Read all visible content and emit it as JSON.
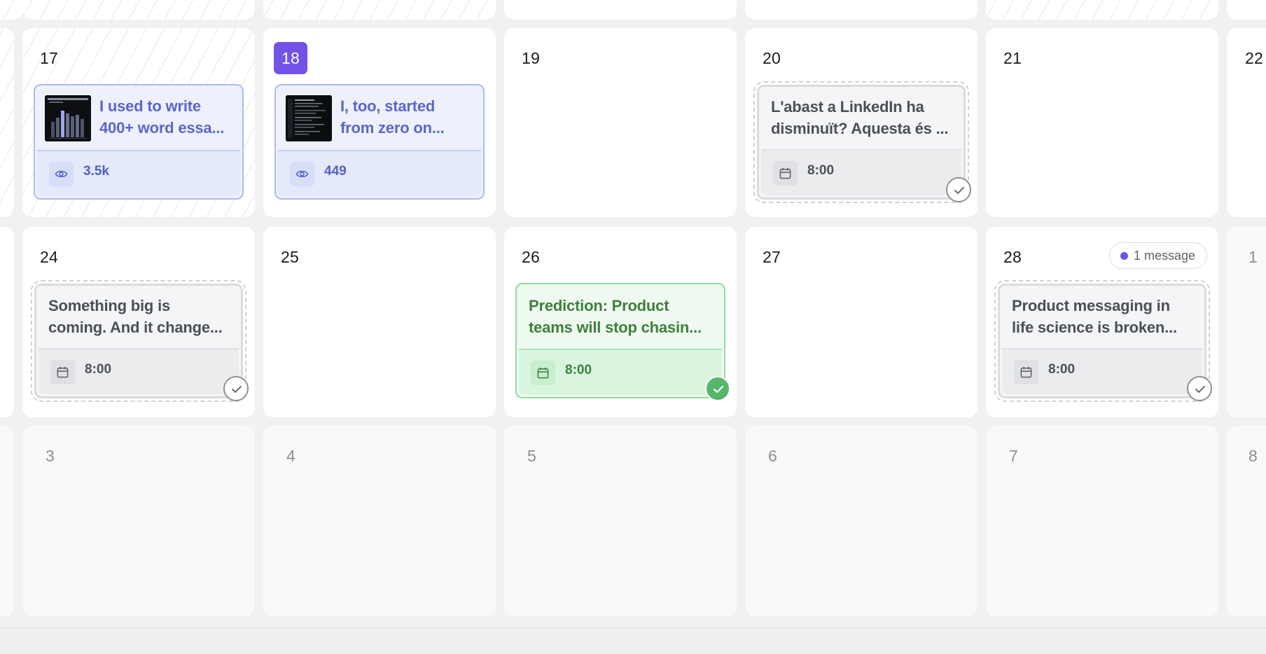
{
  "calendar": {
    "today_day": "18",
    "colors": {
      "today_accent": "#7352e8",
      "published": "#5b66cc",
      "scheduled": "#4c4f55",
      "approved": "#56b66a",
      "message_dot": "#7352e8"
    },
    "weeks": [
      {
        "days": [
          {
            "day": "17",
            "post": {
              "status": "published",
              "title_lines": [
                "I used to write",
                "400+ word essa..."
              ],
              "metric_icon": "eye-icon",
              "metric": "3.5k",
              "has_thumbnail": true
            }
          },
          {
            "day": "18",
            "today": true,
            "post": {
              "status": "published",
              "title_lines": [
                "I, too, started",
                "from zero on..."
              ],
              "metric_icon": "eye-icon",
              "metric": "449",
              "has_thumbnail": true
            }
          },
          {
            "day": "19"
          },
          {
            "day": "20",
            "post": {
              "status": "scheduled",
              "title_lines": [
                "L'abast a LinkedIn ha",
                "disminuït? Aquesta és ..."
              ],
              "metric_icon": "calendar-icon",
              "metric": "8:00",
              "approval": "pending"
            }
          },
          {
            "day": "21"
          },
          {
            "day": "22"
          }
        ]
      },
      {
        "days": [
          {
            "day": "24",
            "post": {
              "status": "scheduled",
              "title_lines": [
                "Something big is",
                "coming. And it change..."
              ],
              "metric_icon": "calendar-icon",
              "metric": "8:00",
              "approval": "pending"
            }
          },
          {
            "day": "25"
          },
          {
            "day": "26",
            "post": {
              "status": "approved",
              "title_lines": [
                "Prediction: Product",
                "teams will stop chasin..."
              ],
              "metric_icon": "calendar-icon",
              "metric": "8:00",
              "approval": "done"
            }
          },
          {
            "day": "27"
          },
          {
            "day": "28",
            "message_badge": "1 message",
            "post": {
              "status": "scheduled",
              "title_lines": [
                "Product messaging in",
                "life science is broken..."
              ],
              "metric_icon": "calendar-icon",
              "metric": "8:00",
              "approval": "pending"
            }
          },
          {
            "day": "1"
          }
        ]
      },
      {
        "days": [
          {
            "day": "3"
          },
          {
            "day": "4"
          },
          {
            "day": "5"
          },
          {
            "day": "6"
          },
          {
            "day": "7"
          },
          {
            "day": "8"
          }
        ]
      }
    ]
  }
}
